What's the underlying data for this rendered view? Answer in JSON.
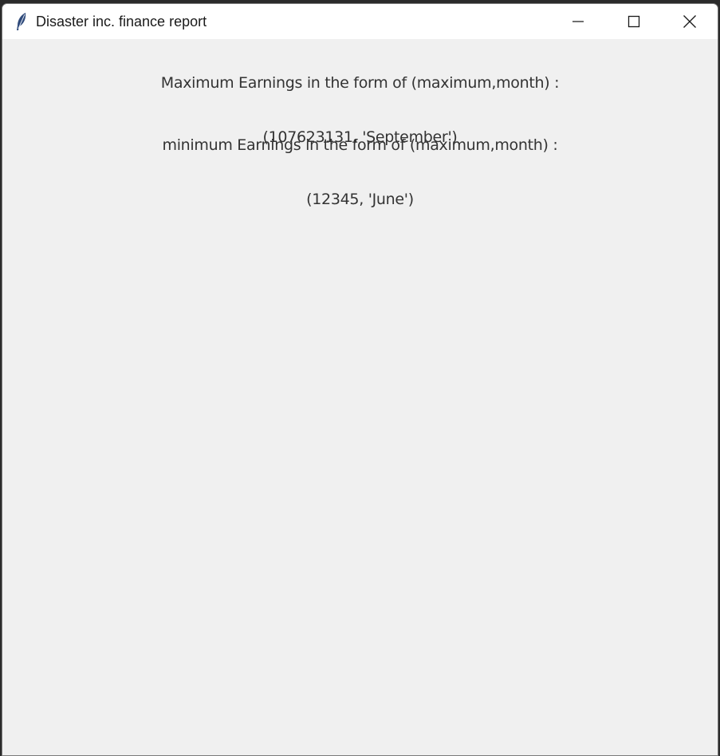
{
  "window": {
    "title": "Disaster inc. finance report",
    "icon": "feather-icon",
    "controls": {
      "minimize_icon": "minimize-icon",
      "maximize_icon": "maximize-icon",
      "close_icon": "close-icon"
    }
  },
  "report": {
    "max_heading": "Maximum Earnings in the form of (maximum,month) :",
    "max_value": "(107623131, 'September')",
    "min_heading": "minimum Earnings in the form of (maximum,month) :",
    "min_value": "(12345, 'June')"
  },
  "colors": {
    "titlebar_bg": "#ffffff",
    "window_bg": "#f0f0f0",
    "text": "#333333",
    "icon_feather": "#2f4a7a"
  }
}
